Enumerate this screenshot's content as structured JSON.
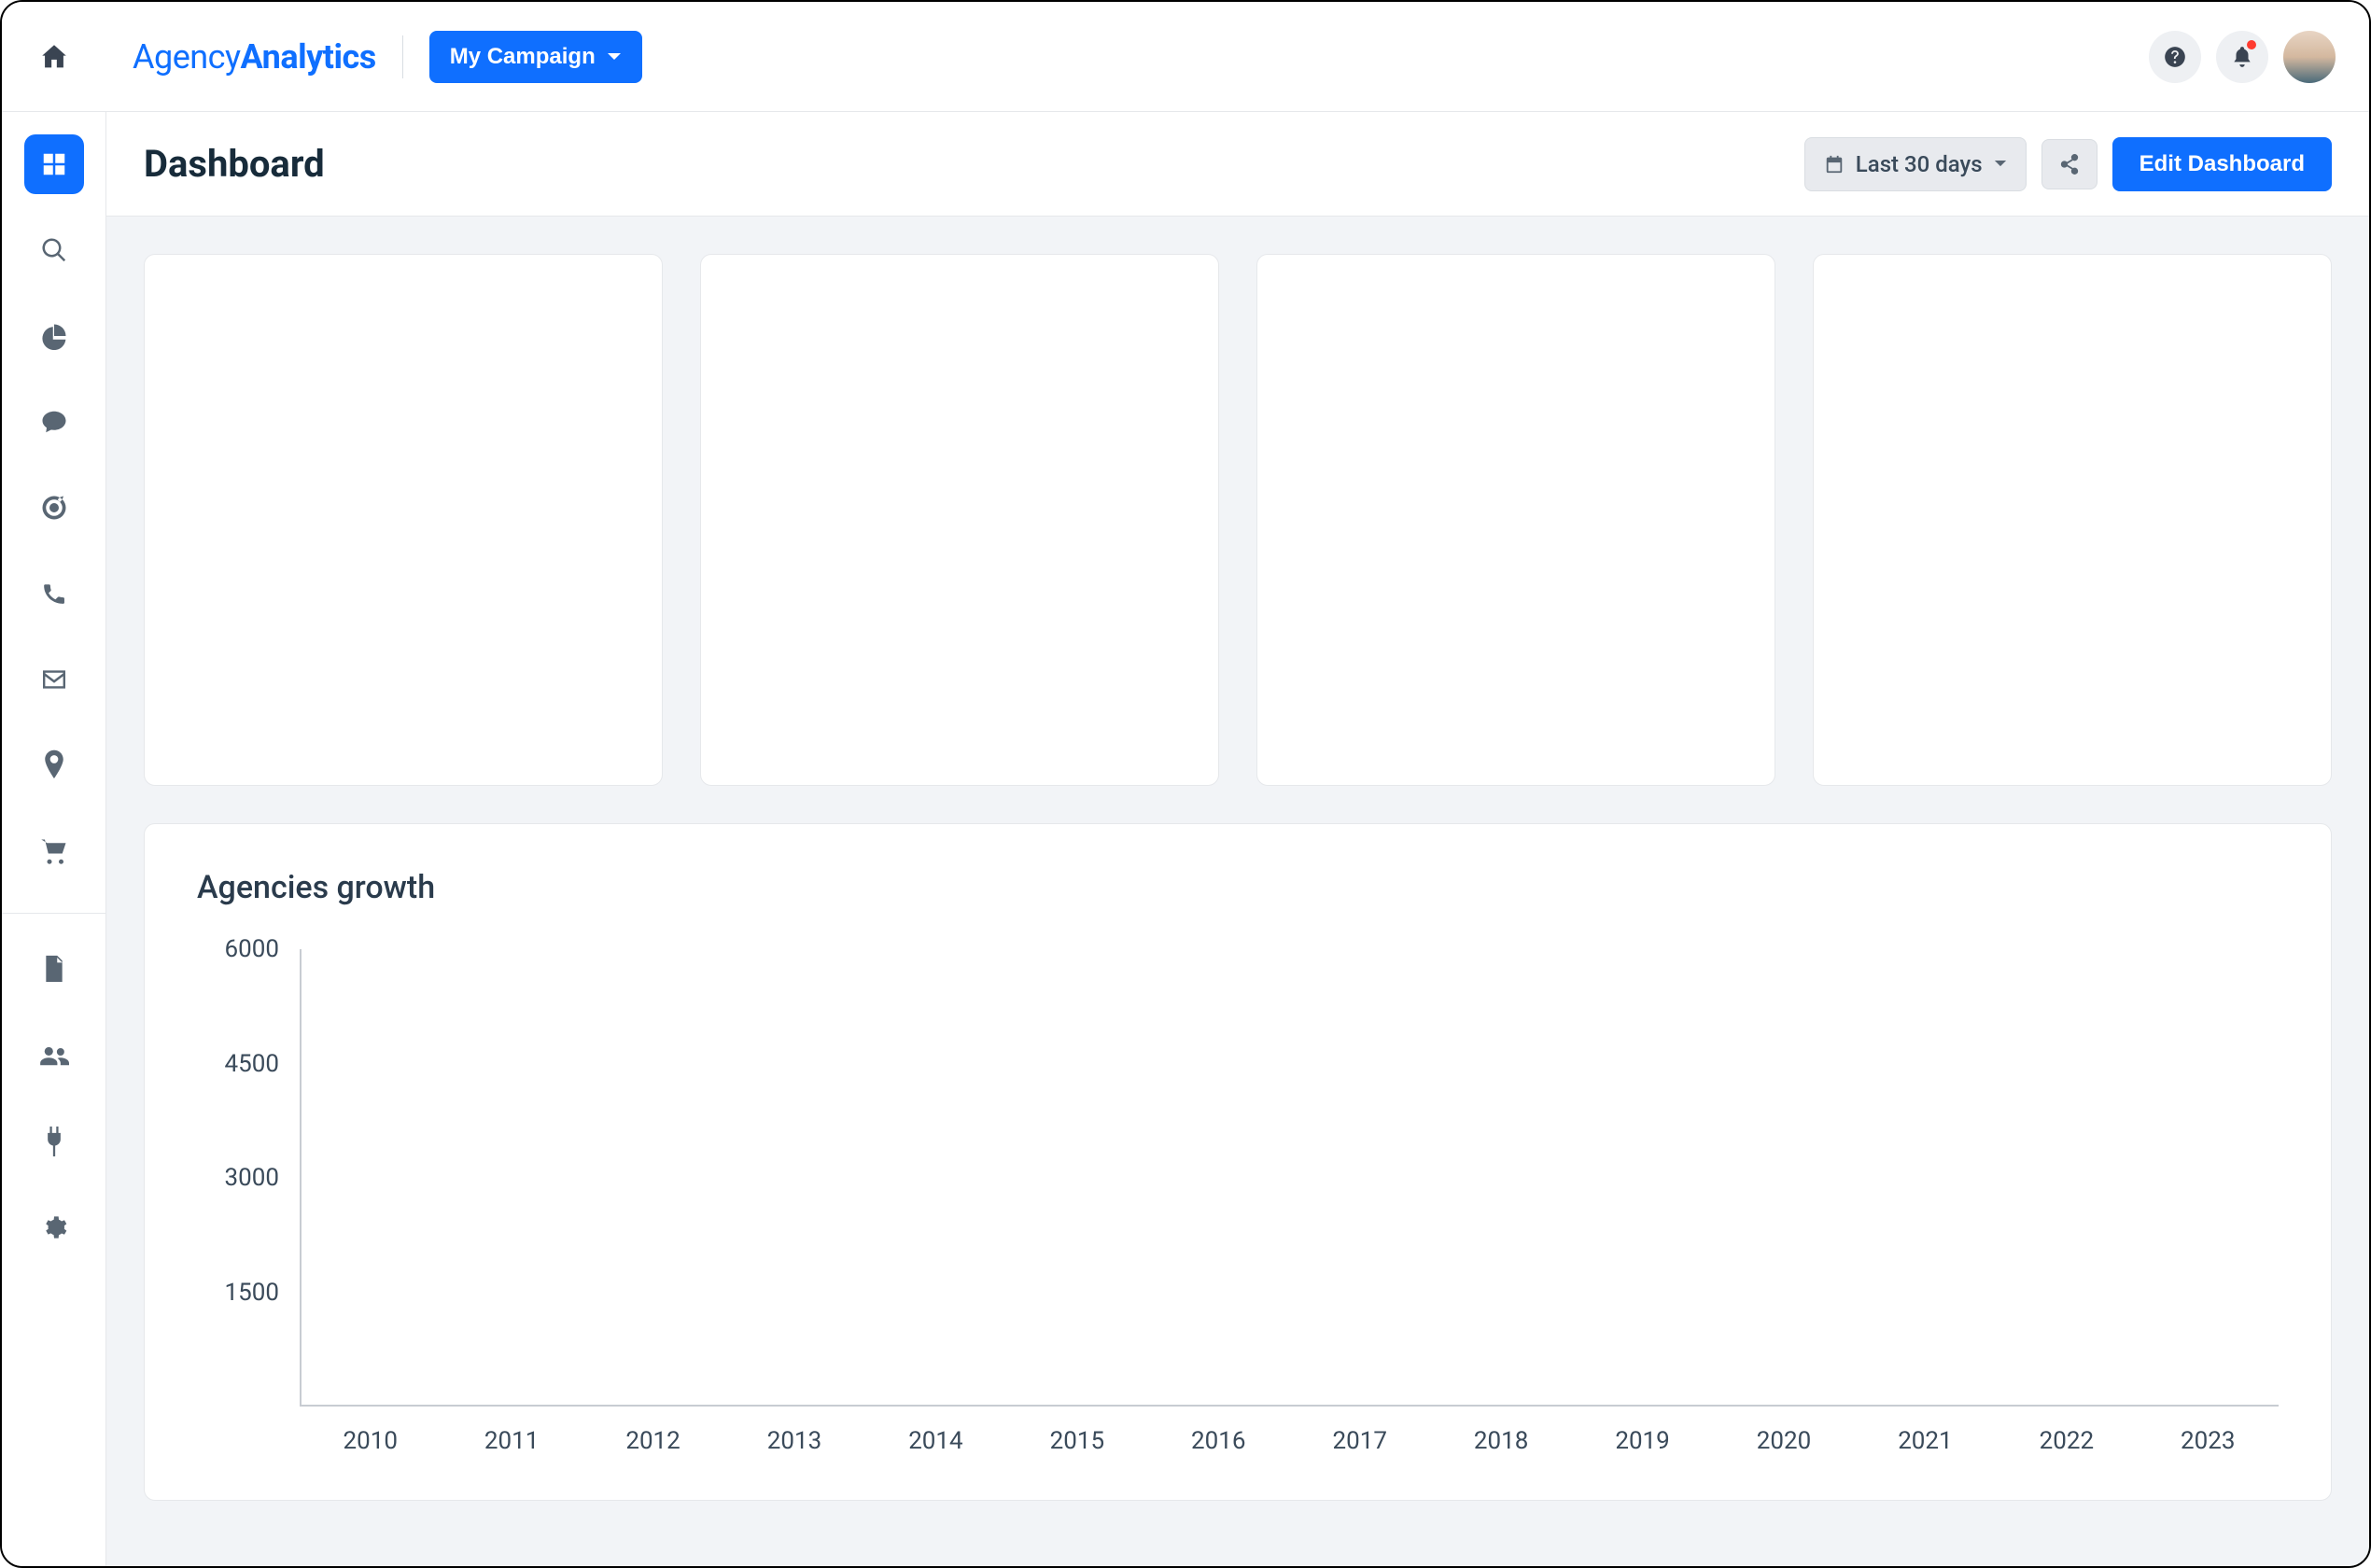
{
  "brand": {
    "part1": "Agency",
    "part2": "Analytics"
  },
  "campaign_label": "My Campaign",
  "header": {
    "page_title": "Dashboard",
    "date_range_label": "Last 30 days",
    "edit_button_label": "Edit Dashboard"
  },
  "chart_data": {
    "type": "line",
    "title": "Agencies growth",
    "xlabel": "",
    "ylabel": "",
    "ylim": [
      0,
      6000
    ],
    "y_ticks": [
      6000,
      4500,
      3000,
      1500
    ],
    "categories": [
      "2010",
      "2011",
      "2012",
      "2013",
      "2014",
      "2015",
      "2016",
      "2017",
      "2018",
      "2019",
      "2020",
      "2021",
      "2022",
      "2023"
    ],
    "values": []
  }
}
